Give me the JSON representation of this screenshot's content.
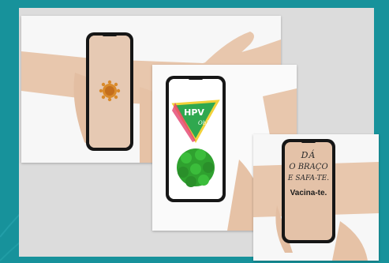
{
  "poster_text": {
    "badge": "HPV",
    "badge_sub": "Oh?",
    "line1": "DÁ",
    "line2": "O BRAÇO",
    "line3": "E SAFA-TE.",
    "line4": "Vacina-te."
  },
  "colors": {
    "background": "#17929b",
    "panel": "#dcdcdc",
    "badge_green": "#2fa84f",
    "badge_yellow": "#f2d23a",
    "virus_green": "#2fa12f",
    "virus_orange": "#d98a2b",
    "skin": "#e8c7ad",
    "phone": "#161616"
  },
  "icons": [
    "virus-icon",
    "hpv-badge-icon"
  ]
}
